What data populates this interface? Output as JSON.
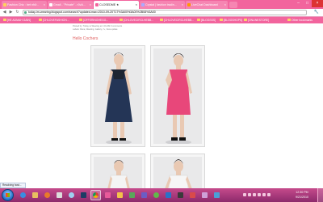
{
  "browser": {
    "tabs": [
      {
        "label": "Fashion Chic : bet nhữ..."
      },
      {
        "label": "Gmail - \"Private\" - r0vA..."
      },
      {
        "label": "CLOSEDME ★"
      },
      {
        "label": "Crystal | fashion tradin..."
      },
      {
        "label": "LiveChat Dashboard"
      }
    ],
    "active_tab": 2,
    "address": "today-im-wearing.blogspot.com/search?updated-max=2010-09-20T17%3A00%3A00%2B08%3A00",
    "bookmarks": [
      "[HE ADMAH GAIN]",
      "[CHLOVEFASHION...",
      "[OFFERINGHEGG...",
      "[CHLOVECIRCLHEBB...",
      "[CHLOVECIRCLHEBB...",
      "[BLOGSSS]",
      "[BLOGSHOPS]",
      "[ONLINESTORE]"
    ],
    "other_bookmarks": "Other bookmarks"
  },
  "page": {
    "meta_line_1": "Posted by: Today ra Wearing at 1:01 AM    0 comments",
    "meta_line_2": "Labels: Rena, Wearing, Gallery, 7+, New update",
    "post_title": "Hello Cochers",
    "photos": [
      {
        "label": "model-navy-lace-dress"
      },
      {
        "label": "model-pink-dress"
      },
      {
        "label": "model-coral-skirt"
      },
      {
        "label": "model-navy-skirt"
      }
    ]
  },
  "status": {
    "text": "Resolving host..."
  },
  "taskbar": {
    "time": "12:30 PM",
    "date": "9/21/2010"
  },
  "colors": {
    "brand_pink": "#f2649d",
    "taskbar": "#a8357a",
    "title": "#e06060"
  }
}
